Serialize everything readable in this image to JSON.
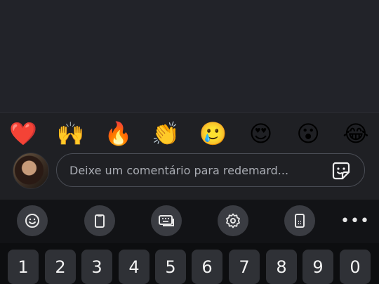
{
  "reactions": [
    {
      "emoji": "❤️",
      "name": "heart"
    },
    {
      "emoji": "🙌",
      "name": "raising-hands"
    },
    {
      "emoji": "🔥",
      "name": "fire"
    },
    {
      "emoji": "👏",
      "name": "clapping-hands"
    },
    {
      "emoji": "🥲",
      "name": "smiling-face-with-tear"
    },
    {
      "emoji": "😍",
      "name": "heart-eyes"
    },
    {
      "emoji": "😮",
      "name": "face-with-open-mouth"
    },
    {
      "emoji": "😂",
      "name": "tears-of-joy"
    }
  ],
  "comment": {
    "placeholder": "Deixe um comentário para redemard..."
  },
  "keyboard_toolbar": {
    "icons": [
      "emoji-icon",
      "clipboard-icon",
      "keyboard-layout-icon",
      "settings-icon",
      "one-handed-icon",
      "more-icon"
    ],
    "more_label": "•••"
  },
  "number_keys": [
    "1",
    "2",
    "3",
    "4",
    "5",
    "6",
    "7",
    "8",
    "9",
    "0"
  ],
  "colors": {
    "background": "#1f2024",
    "input_border": "#4a4d55",
    "toolbar_bg": "#121316",
    "key_bg": "#2f3136"
  }
}
